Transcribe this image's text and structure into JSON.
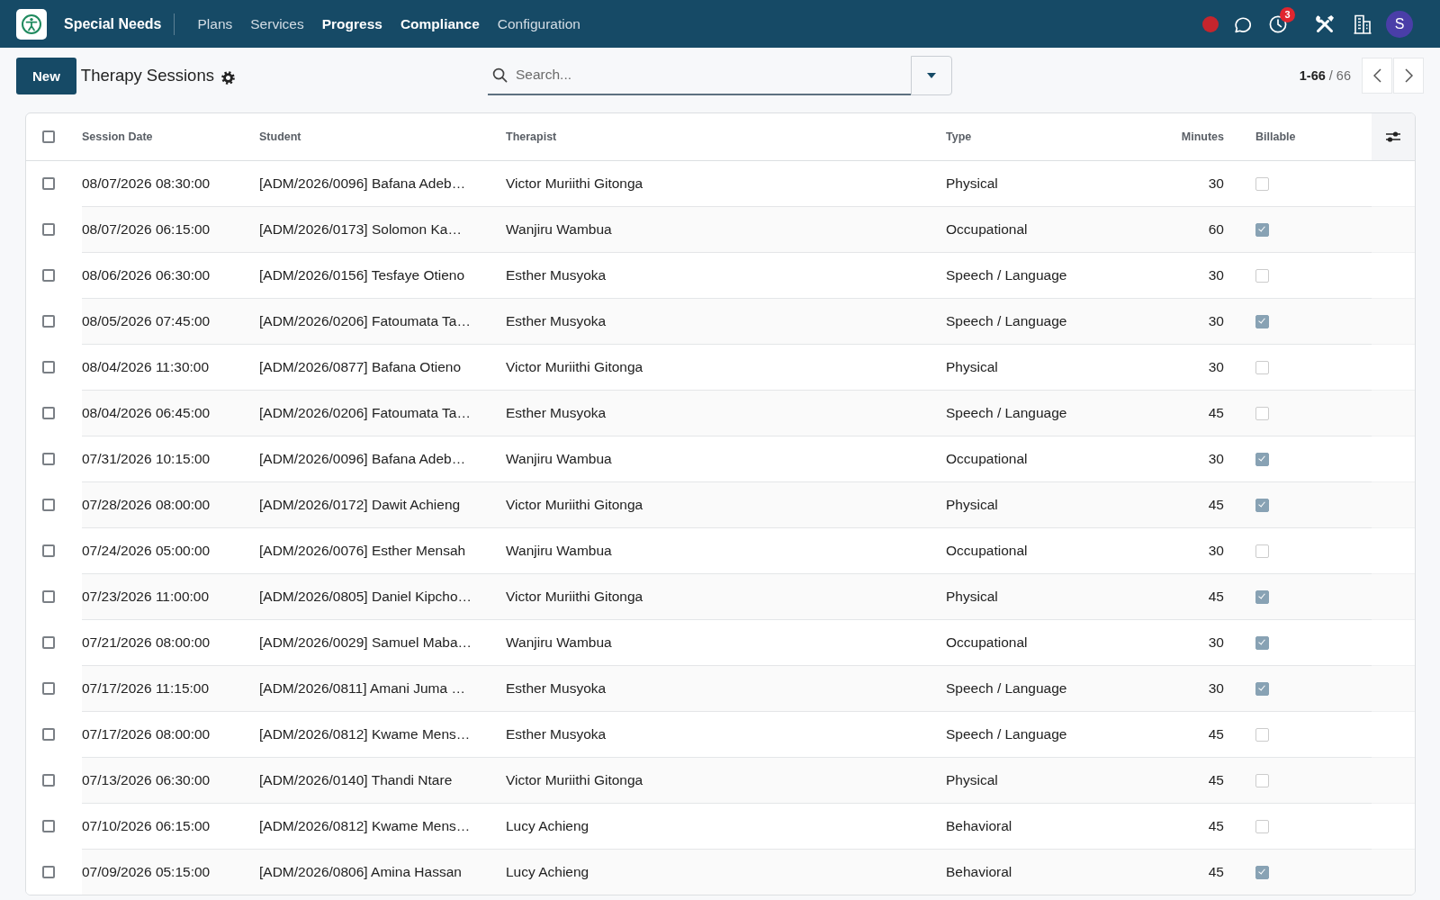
{
  "navbar": {
    "app_name": "Special Needs",
    "menu": [
      {
        "label": "Plans",
        "highlighted": false
      },
      {
        "label": "Services",
        "highlighted": false
      },
      {
        "label": "Progress",
        "highlighted": true
      },
      {
        "label": "Compliance",
        "highlighted": true
      },
      {
        "label": "Configuration",
        "highlighted": false
      }
    ],
    "activity_badge": "3",
    "avatar_initial": "S"
  },
  "control_panel": {
    "new_button": "New",
    "title": "Therapy Sessions",
    "search": {
      "placeholder": "Search..."
    },
    "pager": "**1-66** / 66"
  },
  "table": {
    "select_all": false,
    "columns": [
      {
        "label": "Session Date",
        "kind": "text"
      },
      {
        "label": "Student",
        "kind": "text"
      },
      {
        "label": "Therapist",
        "kind": "text"
      },
      {
        "label": "Type",
        "kind": "text"
      },
      {
        "label": "Minutes",
        "kind": "number"
      },
      {
        "label": "Billable",
        "kind": "boolean"
      }
    ],
    "rows": [
      {
        "selected": false,
        "cells": [
          "08/07/2026 08:30:00",
          "[ADM/2026/0096] Bafana Adeb…",
          "Victor Muriithi Gitonga",
          "Physical",
          "30"
        ],
        "billable": false
      },
      {
        "selected": false,
        "cells": [
          "08/07/2026 06:15:00",
          "[ADM/2026/0173] Solomon Ka…",
          "Wanjiru Wambua",
          "Occupational",
          "60"
        ],
        "billable": true
      },
      {
        "selected": false,
        "cells": [
          "08/06/2026 06:30:00",
          "[ADM/2026/0156] Tesfaye Otieno",
          "Esther Musyoka",
          "Speech / Language",
          "30"
        ],
        "billable": false
      },
      {
        "selected": false,
        "cells": [
          "08/05/2026 07:45:00",
          "[ADM/2026/0206] Fatoumata Ta…",
          "Esther Musyoka",
          "Speech / Language",
          "30"
        ],
        "billable": true
      },
      {
        "selected": false,
        "cells": [
          "08/04/2026 11:30:00",
          "[ADM/2026/0877] Bafana Otieno",
          "Victor Muriithi Gitonga",
          "Physical",
          "30"
        ],
        "billable": false
      },
      {
        "selected": false,
        "cells": [
          "08/04/2026 06:45:00",
          "[ADM/2026/0206] Fatoumata Ta…",
          "Esther Musyoka",
          "Speech / Language",
          "45"
        ],
        "billable": false
      },
      {
        "selected": false,
        "cells": [
          "07/31/2026 10:15:00",
          "[ADM/2026/0096] Bafana Adeb…",
          "Wanjiru Wambua",
          "Occupational",
          "30"
        ],
        "billable": true
      },
      {
        "selected": false,
        "cells": [
          "07/28/2026 08:00:00",
          "[ADM/2026/0172] Dawit Achieng",
          "Victor Muriithi Gitonga",
          "Physical",
          "45"
        ],
        "billable": true
      },
      {
        "selected": false,
        "cells": [
          "07/24/2026 05:00:00",
          "[ADM/2026/0076] Esther Mensah",
          "Wanjiru Wambua",
          "Occupational",
          "30"
        ],
        "billable": false
      },
      {
        "selected": false,
        "cells": [
          "07/23/2026 11:00:00",
          "[ADM/2026/0805] Daniel Kipcho…",
          "Victor Muriithi Gitonga",
          "Physical",
          "45"
        ],
        "billable": true
      },
      {
        "selected": false,
        "cells": [
          "07/21/2026 08:00:00",
          "[ADM/2026/0029] Samuel Maba…",
          "Wanjiru Wambua",
          "Occupational",
          "30"
        ],
        "billable": true
      },
      {
        "selected": false,
        "cells": [
          "07/17/2026 11:15:00",
          "[ADM/2026/0811] Amani Juma …",
          "Esther Musyoka",
          "Speech / Language",
          "30"
        ],
        "billable": true
      },
      {
        "selected": false,
        "cells": [
          "07/17/2026 08:00:00",
          "[ADM/2026/0812] Kwame Mens…",
          "Esther Musyoka",
          "Speech / Language",
          "45"
        ],
        "billable": false
      },
      {
        "selected": false,
        "cells": [
          "07/13/2026 06:30:00",
          "[ADM/2026/0140] Thandi Ntare",
          "Victor Muriithi Gitonga",
          "Physical",
          "45"
        ],
        "billable": false
      },
      {
        "selected": false,
        "cells": [
          "07/10/2026 06:15:00",
          "[ADM/2026/0812] Kwame Mens…",
          "Lucy Achieng",
          "Behavioral",
          "45"
        ],
        "billable": false
      },
      {
        "selected": false,
        "cells": [
          "07/09/2026 05:15:00",
          "[ADM/2026/0806] Amina Hassan",
          "Lucy Achieng",
          "Behavioral",
          "45"
        ],
        "billable": true
      }
    ]
  }
}
